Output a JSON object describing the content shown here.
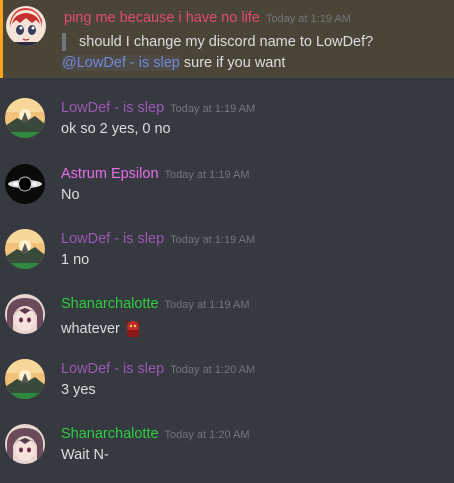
{
  "colors": {
    "background": "#36393f",
    "highlight_bg": "#4a4537",
    "highlight_border": "#faa61a",
    "timestamp": "#72767d",
    "text": "#dcddde",
    "mention": "#7289da"
  },
  "messages": [
    {
      "author": "ping me because i have no life",
      "author_color": "#e24b6f",
      "timestamp": "Today at 1:19 AM",
      "quote": "should I change my discord name to LowDef?",
      "mention": "@LowDef - is slep",
      "text": "sure if you want",
      "avatar": "red-haired-anime-avatar"
    },
    {
      "author": "LowDef - is slep",
      "author_color": "#9b59b6",
      "timestamp": "Today at 1:19 AM",
      "text": "ok so 2 yes, 0 no",
      "avatar": "sunset-landscape-avatar"
    },
    {
      "author": "Astrum Epsilon",
      "author_color": "#e66ee6",
      "timestamp": "Today at 1:19 AM",
      "text": "No",
      "avatar": "black-hole-avatar"
    },
    {
      "author": "LowDef - is slep",
      "author_color": "#9b59b6",
      "timestamp": "Today at 1:19 AM",
      "text": "1 no",
      "avatar": "sunset-landscape-avatar"
    },
    {
      "author": "Shanarchalotte",
      "author_color": "#2ecc40",
      "timestamp": "Today at 1:19 AM",
      "text": "whatever",
      "emoji": "red-demon-emoji",
      "avatar": "anime-girl-avatar"
    },
    {
      "author": "LowDef - is slep",
      "author_color": "#9b59b6",
      "timestamp": "Today at 1:20 AM",
      "text": "3 yes",
      "avatar": "sunset-landscape-avatar"
    },
    {
      "author": "Shanarchalotte",
      "author_color": "#2ecc40",
      "timestamp": "Today at 1:20 AM",
      "text": "Wait N-",
      "avatar": "anime-girl-avatar"
    }
  ]
}
